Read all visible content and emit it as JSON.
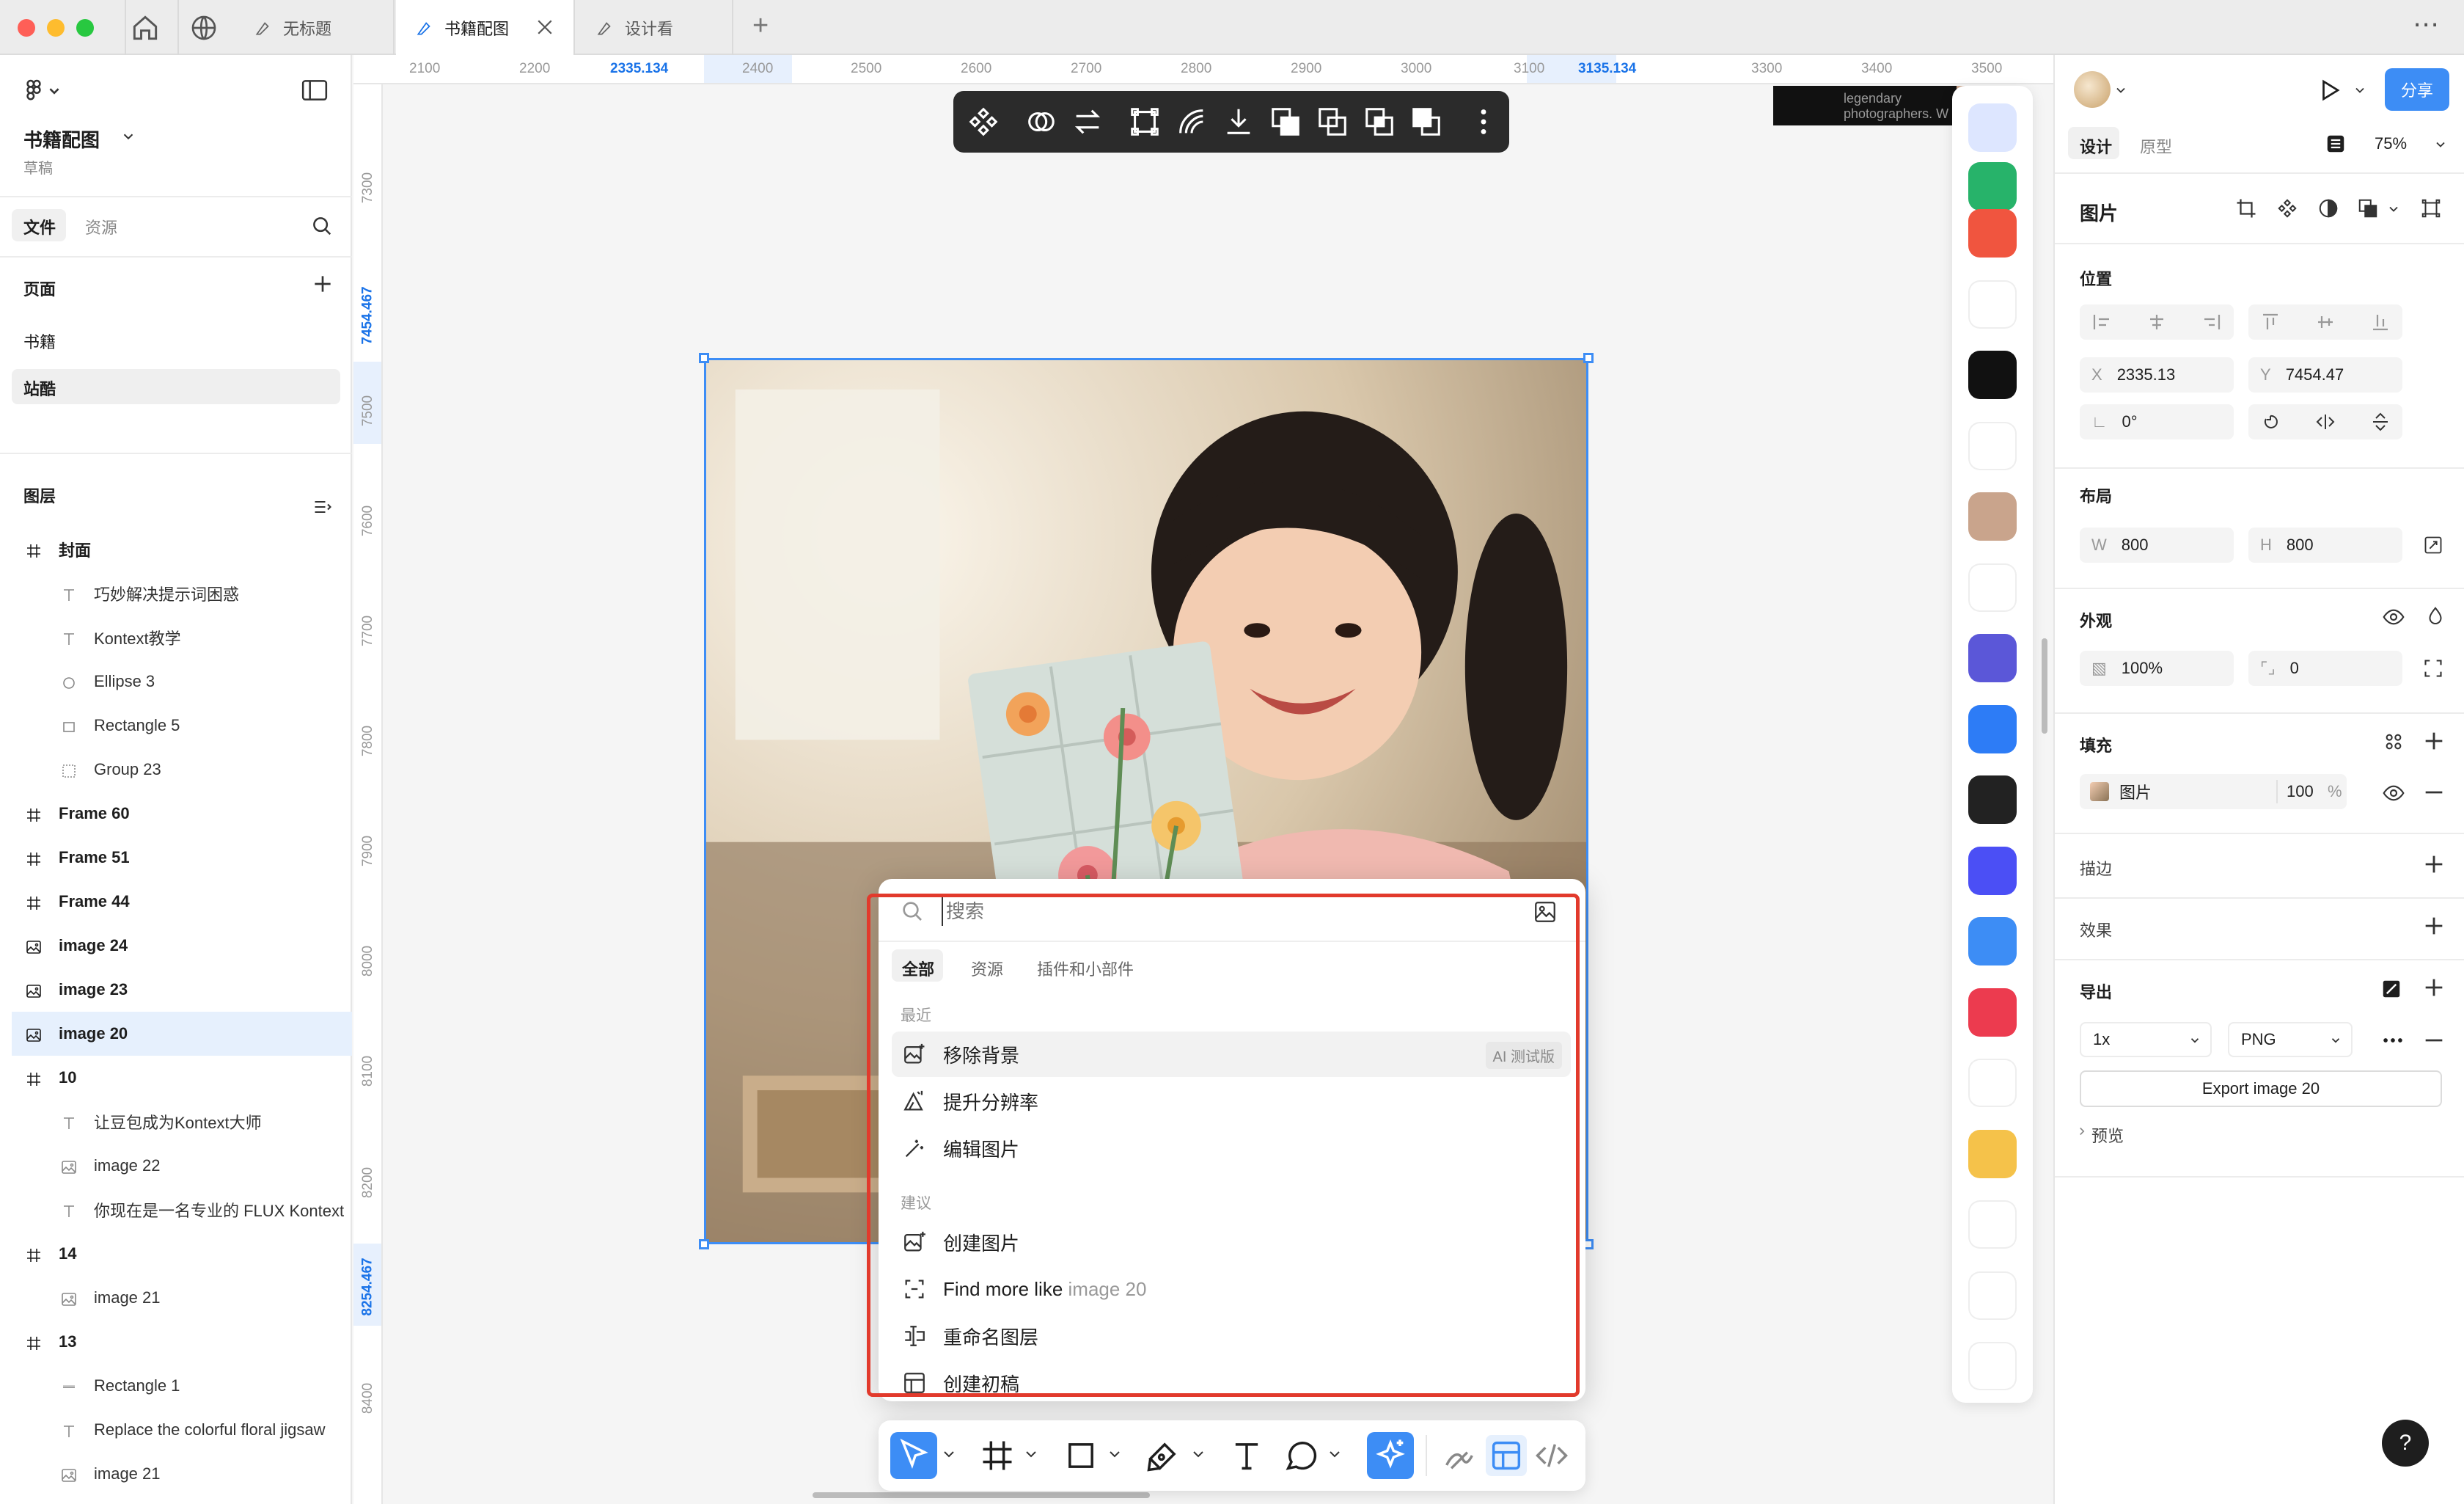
{
  "tabs": {
    "home_icon": "home-icon",
    "globe_icon": "globe-icon",
    "tab1": "无标题",
    "tab2": "书籍配图",
    "tab3": "设计看",
    "add": "+",
    "more": "⋯"
  },
  "left": {
    "project": "书籍配图",
    "status": "草稿",
    "tab_files": "文件",
    "tab_assets": "资源",
    "pages_title": "页面",
    "pages": [
      "书籍",
      "站酷"
    ],
    "layers_title": "图层",
    "layers": [
      {
        "name": "封面",
        "type": "frame",
        "child": false
      },
      {
        "name": "巧妙解决提示词困惑",
        "type": "text",
        "child": true
      },
      {
        "name": "Kontext教学",
        "type": "text",
        "child": true
      },
      {
        "name": "Ellipse 3",
        "type": "ellipse",
        "child": true
      },
      {
        "name": "Rectangle 5",
        "type": "rect",
        "child": true
      },
      {
        "name": "Group 23",
        "type": "group",
        "child": true
      },
      {
        "name": "Frame 60",
        "type": "frame",
        "child": false
      },
      {
        "name": "Frame 51",
        "type": "frame",
        "child": false
      },
      {
        "name": "Frame 44",
        "type": "frame",
        "child": false
      },
      {
        "name": "image 24",
        "type": "image",
        "child": false
      },
      {
        "name": "image 23",
        "type": "image",
        "child": false
      },
      {
        "name": "image 20",
        "type": "image",
        "child": false,
        "selected": true
      },
      {
        "name": "10",
        "type": "frame",
        "child": false
      },
      {
        "name": "让豆包成为Kontext大师",
        "type": "text",
        "child": true
      },
      {
        "name": "image 22",
        "type": "image",
        "child": true
      },
      {
        "name": "你现在是一名专业的 FLUX Kontext",
        "type": "text",
        "child": true
      },
      {
        "name": "14",
        "type": "frame",
        "child": false
      },
      {
        "name": "image 21",
        "type": "image",
        "child": true
      },
      {
        "name": "13",
        "type": "frame",
        "child": false
      },
      {
        "name": "Rectangle 1",
        "type": "line",
        "child": true
      },
      {
        "name": "Replace the colorful floral jigsaw",
        "type": "text",
        "child": true
      },
      {
        "name": "image 21",
        "type": "image",
        "child": true
      }
    ]
  },
  "ruler_x": [
    "2100",
    "2200",
    "2335.134",
    "2400",
    "2500",
    "2600",
    "2700",
    "2800",
    "2900",
    "3000",
    "3100",
    "3135.134",
    "3300",
    "3400",
    "3500"
  ],
  "ruler_y": [
    "7300",
    "7454.467",
    "7500",
    "7600",
    "7700",
    "7800",
    "7900",
    "8000",
    "8100",
    "8200",
    "8254.467",
    "8400"
  ],
  "canvas": {
    "thumb_text1": "legendary",
    "thumb_text2": "photographers. W"
  },
  "popup": {
    "search_placeholder": "搜索",
    "tabs": [
      "全部",
      "资源",
      "插件和小部件"
    ],
    "recent_title": "最近",
    "recent": [
      {
        "label": "移除背景",
        "badge": "AI 测试版"
      },
      {
        "label": "提升分辨率"
      },
      {
        "label": "编辑图片"
      }
    ],
    "suggest_title": "建议",
    "suggest": [
      {
        "label": "创建图片"
      },
      {
        "label": "Find more like",
        "extra": "image 20"
      },
      {
        "label": "重命名图层"
      },
      {
        "label": "创建初稿"
      }
    ]
  },
  "right": {
    "tab_design": "设计",
    "tab_proto": "原型",
    "zoom": "75%",
    "share": "分享",
    "section_image": "图片",
    "pos_title": "位置",
    "x_label": "X",
    "x_value": "2335.13",
    "y_label": "Y",
    "y_value": "7454.47",
    "rot_value": "0°",
    "layout_title": "布局",
    "w_label": "W",
    "w_value": "800",
    "h_label": "H",
    "h_value": "800",
    "appearance_title": "外观",
    "opacity": "100%",
    "radius": "0",
    "fill_title": "填充",
    "fill_name": "图片",
    "fill_opacity": "100",
    "fill_pct": "%",
    "stroke_title": "描边",
    "effects_title": "效果",
    "export_title": "导出",
    "export_scale": "1x",
    "export_format": "PNG",
    "export_button": "Export image 20",
    "preview": "预览",
    "help": "?"
  },
  "plugins": [
    {
      "name": "plugin-blue-grid",
      "color": "#dde6ff"
    },
    {
      "name": "plugin-green",
      "color": "#27b36a"
    },
    {
      "name": "plugin-chart",
      "color": "#f0553f"
    },
    {
      "name": "plugin-unsplash",
      "color": "#ffffff"
    },
    {
      "name": "plugin-f",
      "color": "#111111"
    },
    {
      "name": "plugin-orange",
      "color": "#ffffff"
    },
    {
      "name": "plugin-avatar",
      "color": "#c9a48c"
    },
    {
      "name": "plugin-p",
      "color": "#ffffff"
    },
    {
      "name": "plugin-emoji",
      "color": "#5b57d8"
    },
    {
      "name": "plugin-truck",
      "color": "#2d7cf6"
    },
    {
      "name": "plugin-ring",
      "color": "#222222"
    },
    {
      "name": "plugin-zi",
      "color": "#4b4ff5"
    },
    {
      "name": "plugin-table",
      "color": "#3d8df5"
    },
    {
      "name": "plugin-book",
      "color": "#ec3b4f"
    },
    {
      "name": "plugin-lines",
      "color": "#ffffff"
    },
    {
      "name": "plugin-box",
      "color": "#f5c24a"
    },
    {
      "name": "plugin-planet",
      "color": "#ffffff"
    },
    {
      "name": "plugin-owl",
      "color": "#ffffff"
    },
    {
      "name": "plugin-snow",
      "color": "#ffffff"
    }
  ]
}
